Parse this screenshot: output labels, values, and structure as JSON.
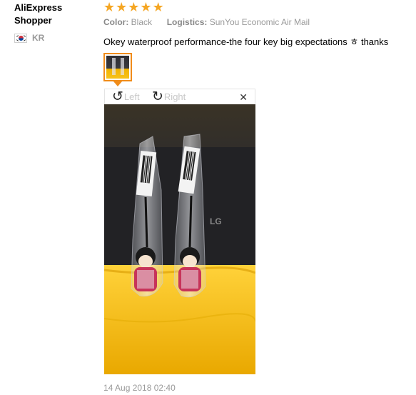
{
  "user": {
    "name": "AliExpress Shopper",
    "country_code": "KR",
    "flag_icon": "south-korea-flag-icon"
  },
  "rating": {
    "stars": 5,
    "max": 5,
    "color": "#f5a623"
  },
  "meta": {
    "color_label": "Color:",
    "color_value": "Black",
    "logistics_label": "Logistics:",
    "logistics_value": "SunYou Economic Air Mail"
  },
  "review": {
    "text": "Okey waterproof performance-the four key big expectations ㅎ thanks"
  },
  "viewer": {
    "rotate_left_label": "Left",
    "rotate_right_label": "Right",
    "accent_color": "#f08c1a"
  },
  "date": "14 Aug 2018 02:40"
}
